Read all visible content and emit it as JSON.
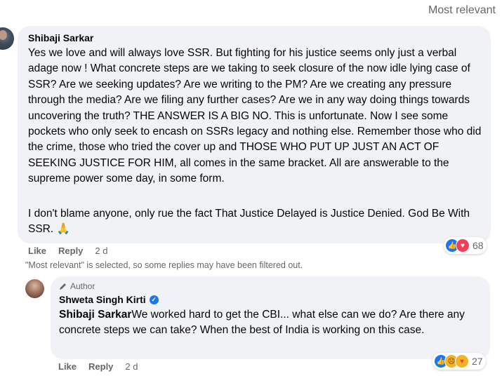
{
  "header": {
    "sort_label": "Most relevant"
  },
  "comment": {
    "author": "Shibaji Sarkar",
    "paragraph1": "Yes we love and will always love SSR. But fighting for his justice seems only just a verbal adage now ! What concrete steps are we taking to seek closure of the now idle lying case of SSR? Are we seeking updates? Are we writing to the PM? Are we creating any pressure through the media? Are we filing any further cases? Are we in any way doing things towards uncovering the truth? THE ANSWER IS A BIG NO. This is unfortunate. Now I see some pockets who only seek to encash on SSRs legacy and nothing else. Remember those who did the crime, those who tried the cover up and THOSE WHO PUT UP JUST AN ACT OF SEEKING JUSTICE FOR HIM, all comes in the same bracket. All are answerable to the supreme power some day, in some form.",
    "paragraph2": "I don't blame anyone, only rue the fact That Justice Delayed is Justice Denied. God Be With SSR.",
    "emoji": "🙏",
    "actions": {
      "like": "Like",
      "reply": "Reply",
      "time": "2 d"
    },
    "reactions": {
      "icons": [
        "like-icon",
        "love-icon"
      ],
      "count": "68"
    }
  },
  "filter_note": "\"Most relevant\" is selected, so some replies may have been filtered out.",
  "reply": {
    "badge": "Author",
    "author": "Shweta Singh Kirti",
    "mention": "Shibaji Sarkar",
    "text": "We worked hard to get the CBI... what else can we do? Are there any concrete steps we can take? When the best of India is working on this case.",
    "actions": {
      "like": "Like",
      "reply": "Reply",
      "time": "2 d"
    },
    "reactions": {
      "icons": [
        "like-icon",
        "sad-icon",
        "care-icon"
      ],
      "count": "27"
    }
  },
  "colors": {
    "bubble": "#f0f2f5",
    "secondary_text": "#65676b",
    "like_blue": "#1877f2",
    "love_red": "#f33e58"
  }
}
